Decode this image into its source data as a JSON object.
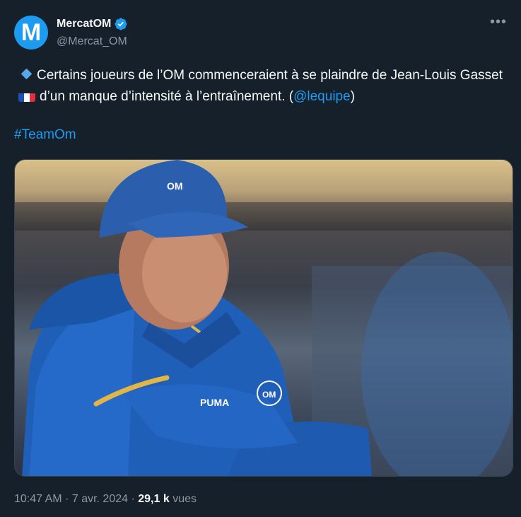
{
  "author": {
    "display_name": "MercatOM",
    "handle": "@Mercat_OM",
    "avatar_letter": "M",
    "verified": true
  },
  "tweet": {
    "text_part1": "Certains joueurs de l’OM commenceraient à se plaindre de Jean-Louis Gasset",
    "text_part2": "d’un manque d’intensité à l’entraînement. (",
    "mention": "@lequipe",
    "text_part3": ")",
    "hashtag": "#TeamOm",
    "icons": [
      "blue-diamond-icon",
      "france-flag-icon"
    ]
  },
  "media": {
    "jacket_brand": "PUMA"
  },
  "meta": {
    "time": "10:47 AM",
    "separator": "·",
    "date": "7 avr. 2024",
    "views_count": "29,1 k",
    "views_label": "vues"
  },
  "colors": {
    "background": "#15202b",
    "accent": "#1d9bf0",
    "secondary_text": "#8b98a5"
  }
}
